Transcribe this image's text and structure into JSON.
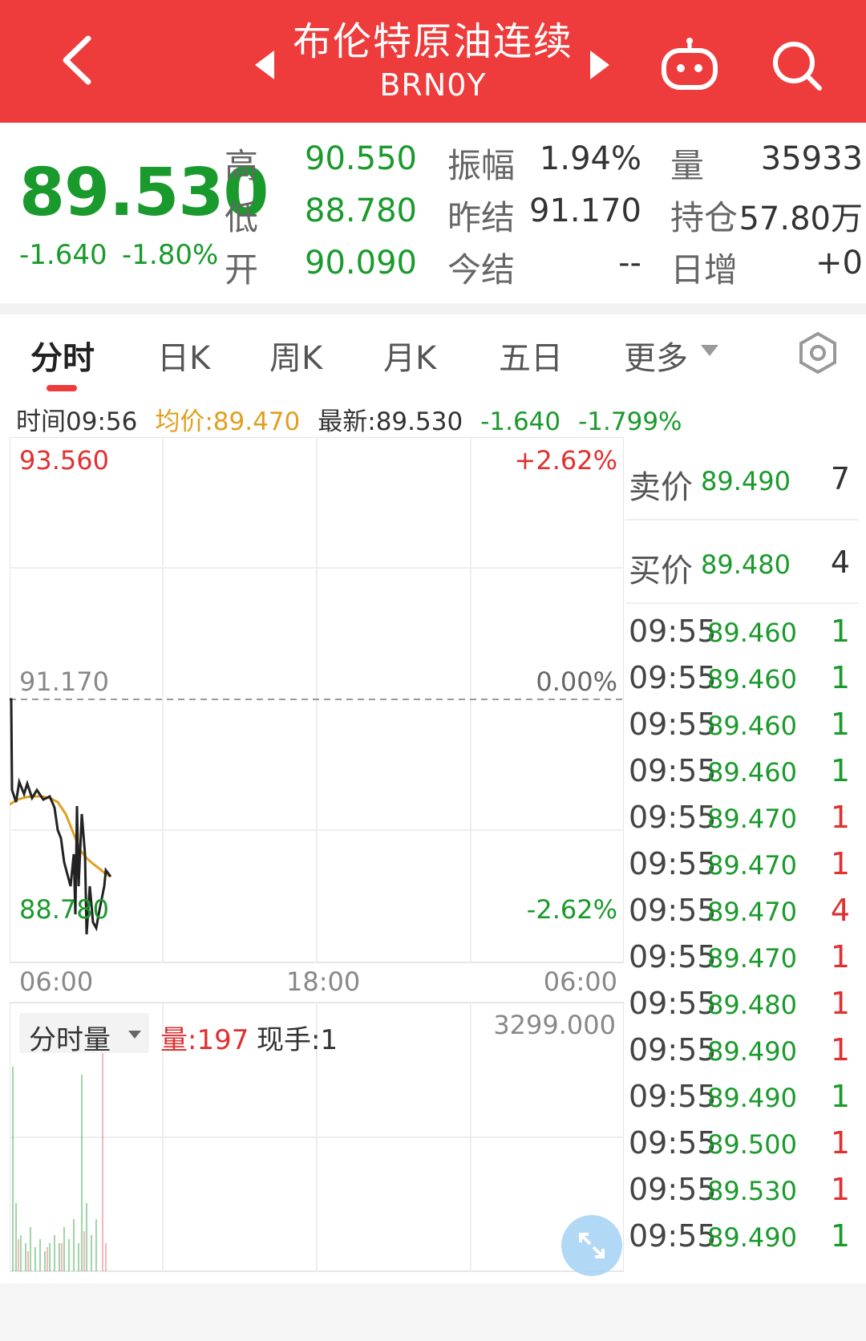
{
  "header": {
    "title": "布伦特原油连续",
    "code": "BRN0Y"
  },
  "quote": {
    "price": "89.530",
    "change": "-1.640",
    "change_pct": "-1.80%",
    "high_label": "高",
    "high": "90.550",
    "low_label": "低",
    "low": "88.780",
    "open_label": "开",
    "open": "90.090",
    "amp_label": "振幅",
    "amp": "1.94%",
    "prev_label": "昨结",
    "prev": "91.170",
    "settle_label": "今结",
    "settle": "--",
    "vol_label": "量",
    "vol": "35933",
    "oi_label": "持仓",
    "oi": "57.80万",
    "daily_inc_label": "日增",
    "daily_inc": "+0"
  },
  "tabs": [
    {
      "label": "分时",
      "active": true
    },
    {
      "label": "日K"
    },
    {
      "label": "周K"
    },
    {
      "label": "月K"
    },
    {
      "label": "五日"
    },
    {
      "label": "更多"
    }
  ],
  "info": {
    "time": "时间09:56",
    "avg": "均价:89.470",
    "latest": "最新:89.530",
    "chg": "-1.640",
    "chg_pct": "-1.799%"
  },
  "chart": {
    "top_price": "93.560",
    "top_pct": "+2.62%",
    "mid_price": "91.170",
    "mid_pct": "0.00%",
    "bottom_price": "88.780",
    "bottom_pct": "-2.62%",
    "x_ticks": [
      "06:00",
      "18:00",
      "06:00"
    ],
    "vol_selector": "分时量",
    "vol_now": "量:197",
    "hand_now": "现手:1",
    "vol_max": "3299.000"
  },
  "book": {
    "ask_label": "卖价",
    "ask_price": "89.490",
    "ask_vol": "7",
    "bid_label": "买价",
    "bid_price": "89.480",
    "bid_vol": "4"
  },
  "trades": [
    {
      "time": "09:55",
      "price": "89.460",
      "vol": "1",
      "side": "sell"
    },
    {
      "time": "09:55",
      "price": "89.460",
      "vol": "1",
      "side": "sell"
    },
    {
      "time": "09:55",
      "price": "89.460",
      "vol": "1",
      "side": "sell"
    },
    {
      "time": "09:55",
      "price": "89.460",
      "vol": "1",
      "side": "sell"
    },
    {
      "time": "09:55",
      "price": "89.470",
      "vol": "1",
      "side": "buy"
    },
    {
      "time": "09:55",
      "price": "89.470",
      "vol": "1",
      "side": "buy"
    },
    {
      "time": "09:55",
      "price": "89.470",
      "vol": "4",
      "side": "buy"
    },
    {
      "time": "09:55",
      "price": "89.470",
      "vol": "1",
      "side": "buy"
    },
    {
      "time": "09:55",
      "price": "89.480",
      "vol": "1",
      "side": "buy"
    },
    {
      "time": "09:55",
      "price": "89.490",
      "vol": "1",
      "side": "buy"
    },
    {
      "time": "09:55",
      "price": "89.490",
      "vol": "1",
      "side": "sell"
    },
    {
      "time": "09:55",
      "price": "89.500",
      "vol": "1",
      "side": "buy"
    },
    {
      "time": "09:55",
      "price": "89.530",
      "vol": "1",
      "side": "buy"
    },
    {
      "time": "09:55",
      "price": "89.490",
      "vol": "1",
      "side": "sell"
    }
  ],
  "colors": {
    "brand_red": "#ee3b3b",
    "down_green": "#1a9a2c",
    "up_red": "#e03030",
    "avg_line": "#e0a020",
    "price_line": "#222222"
  }
}
